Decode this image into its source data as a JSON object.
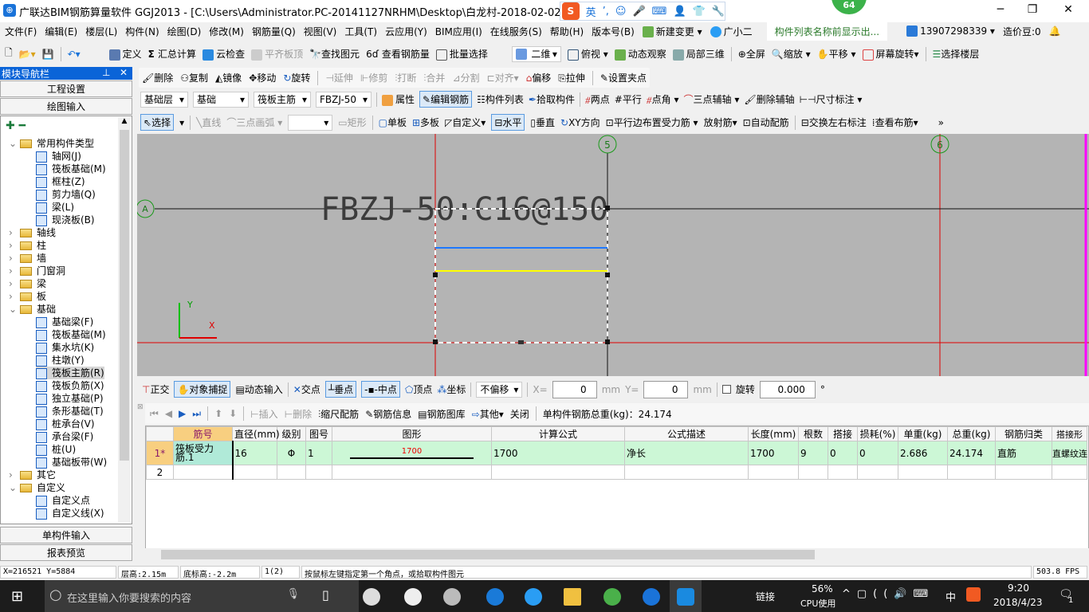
{
  "window": {
    "title": "广联达BIM钢筋算量软件 GGJ2013 - [C:\\Users\\Administrator.PC-20141127NRHM\\Desktop\\白龙村-2018-02-02-19-24-35",
    "minimize": "─",
    "restore": "❐",
    "close": "✕",
    "badge": "64"
  },
  "ime": {
    "logo": "S",
    "lang": "英",
    "items": [
      "’,",
      "☺",
      "🎤",
      "⌨",
      "👤",
      "👕",
      "🔧"
    ]
  },
  "menu": {
    "items": [
      "文件(F)",
      "编辑(E)",
      "楼层(L)",
      "构件(N)",
      "绘图(D)",
      "修改(M)",
      "钢筋量(Q)",
      "视图(V)",
      "工具(T)",
      "云应用(Y)",
      "BIM应用(I)",
      "在线服务(S)",
      "帮助(H)",
      "版本号(B)",
      "新建变更",
      "广小二"
    ],
    "hint": "构件列表名称前显示出...",
    "phone": "13907298339",
    "beans": "造价豆:0"
  },
  "toolbar1": {
    "items": [
      "定义",
      "汇总计算",
      "云检查",
      "平齐板顶",
      "查找图元",
      "查看钢筋量",
      "批量选择"
    ],
    "view": "二维",
    "items2": [
      "俯视",
      "动态观察",
      "局部三维",
      "全屏",
      "缩放",
      "平移",
      "屏幕旋转",
      "选择楼层"
    ]
  },
  "toolbar2": {
    "items": [
      "删除",
      "复制",
      "镜像",
      "移动",
      "旋转",
      "延伸",
      "修剪",
      "打断",
      "合并",
      "分割",
      "对齐",
      "偏移",
      "拉伸",
      "设置夹点"
    ]
  },
  "toolbar3": {
    "floor": "基础层",
    "category": "基础",
    "type": "筏板主筋",
    "name": "FBZJ-50",
    "items": [
      "属性",
      "编辑钢筋",
      "构件列表",
      "拾取构件",
      "两点",
      "平行",
      "点角",
      "三点辅轴",
      "删除辅轴",
      "尺寸标注"
    ]
  },
  "toolbar4": {
    "items": [
      "选择",
      "直线",
      "三点画弧",
      "矩形",
      "单板",
      "多板",
      "自定义",
      "水平",
      "垂直",
      "XY方向",
      "平行边布置受力筋",
      "放射筋",
      "自动配筋",
      "交换左右标注",
      "查看布筋"
    ]
  },
  "nav": {
    "title": "模块导航栏",
    "pin": "📌",
    "close": "✕",
    "btn_project": "工程设置",
    "btn_draw": "绘图输入",
    "btn_single": "单构件输入",
    "btn_report": "报表预览",
    "tree": [
      {
        "label": "常用构件类型",
        "level": 0,
        "folder": true,
        "open": true
      },
      {
        "label": "轴网(J)",
        "level": 1
      },
      {
        "label": "筏板基础(M)",
        "level": 1
      },
      {
        "label": "框柱(Z)",
        "level": 1
      },
      {
        "label": "剪力墙(Q)",
        "level": 1
      },
      {
        "label": "梁(L)",
        "level": 1
      },
      {
        "label": "现浇板(B)",
        "level": 1
      },
      {
        "label": "轴线",
        "level": 0,
        "folder": true
      },
      {
        "label": "柱",
        "level": 0,
        "folder": true
      },
      {
        "label": "墙",
        "level": 0,
        "folder": true
      },
      {
        "label": "门窗洞",
        "level": 0,
        "folder": true
      },
      {
        "label": "梁",
        "level": 0,
        "folder": true
      },
      {
        "label": "板",
        "level": 0,
        "folder": true
      },
      {
        "label": "基础",
        "level": 0,
        "folder": true,
        "open": true
      },
      {
        "label": "基础梁(F)",
        "level": 1
      },
      {
        "label": "筏板基础(M)",
        "level": 1
      },
      {
        "label": "集水坑(K)",
        "level": 1
      },
      {
        "label": "柱墩(Y)",
        "level": 1
      },
      {
        "label": "筏板主筋(R)",
        "level": 1,
        "selected": true
      },
      {
        "label": "筏板负筋(X)",
        "level": 1
      },
      {
        "label": "独立基础(P)",
        "level": 1
      },
      {
        "label": "条形基础(T)",
        "level": 1
      },
      {
        "label": "桩承台(V)",
        "level": 1
      },
      {
        "label": "承台梁(F)",
        "level": 1
      },
      {
        "label": "桩(U)",
        "level": 1
      },
      {
        "label": "基础板带(W)",
        "level": 1
      },
      {
        "label": "其它",
        "level": 0,
        "folder": true
      },
      {
        "label": "自定义",
        "level": 0,
        "folder": true,
        "open": true
      },
      {
        "label": "自定义点",
        "level": 1
      },
      {
        "label": "自定义线(X)",
        "level": 1
      }
    ]
  },
  "canvas": {
    "label": "FBZJ-50:C16@150",
    "axes": [
      "5",
      "6",
      "A"
    ],
    "y_label": "Y",
    "x_label": "X",
    "colors": {
      "bg": "#b4b4b4",
      "grid_red": "#e00000",
      "rebar_blue": "#1e78ff",
      "rebar_yellow": "#ffff00",
      "axis_circle": "#1a9a1a"
    }
  },
  "snapbar": {
    "items": [
      "正交",
      "对象捕捉",
      "动态输入",
      "交点",
      "垂点",
      "中点",
      "顶点",
      "坐标"
    ],
    "offset": "不偏移",
    "x_label": "X=",
    "x_val": "0",
    "y_label": "Y=",
    "y_val": "0",
    "unit": "mm",
    "rotate": "旋转",
    "rotate_val": "0.000",
    "deg": "°"
  },
  "rebarbar": {
    "items": [
      "插入",
      "删除",
      "缩尺配筋",
      "钢筋信息",
      "钢筋图库",
      "其他",
      "关闭"
    ],
    "total": "单构件钢筋总重(kg)：24.174"
  },
  "grid": {
    "headers": [
      "",
      "筋号",
      "直径(mm)",
      "级别",
      "图号",
      "图形",
      "计算公式",
      "公式描述",
      "长度(mm)",
      "根数",
      "搭接",
      "损耗(%)",
      "单重(kg)",
      "总重(kg)",
      "钢筋归类",
      "搭接形"
    ],
    "rows": [
      {
        "num": "1*",
        "name": "筏板受力筋.1",
        "dia": "16",
        "grade": "Φ",
        "fig": "1",
        "shape": "1700",
        "formula": "1700",
        "desc": "净长",
        "len": "1700",
        "count": "9",
        "lap": "0",
        "loss": "0",
        "unit_w": "2.686",
        "total_w": "24.174",
        "cls": "直筋",
        "lap_type": "直螺纹连"
      },
      {
        "num": "2",
        "name": "",
        "dia": "",
        "grade": "",
        "fig": "",
        "shape": "",
        "formula": "",
        "desc": "",
        "len": "",
        "count": "",
        "lap": "",
        "loss": "",
        "unit_w": "",
        "total_w": "",
        "cls": "",
        "lap_type": ""
      }
    ]
  },
  "status": {
    "coords": "X=216521 Y=5884",
    "floor_h": "层高:2.15m",
    "base_h": "底标高:-2.2m",
    "layer": "1(2)",
    "hint": "按鼠标左键指定第一个角点，或拾取构件图元",
    "fps": "503.8 FPS"
  },
  "taskbar": {
    "search": "在这里输入你要搜索的内容",
    "link": "链接",
    "cpu": "56%",
    "cpu_label": "CPU使用",
    "lang": "中",
    "time": "9:20",
    "date": "2018/4/23",
    "notif": "1"
  }
}
